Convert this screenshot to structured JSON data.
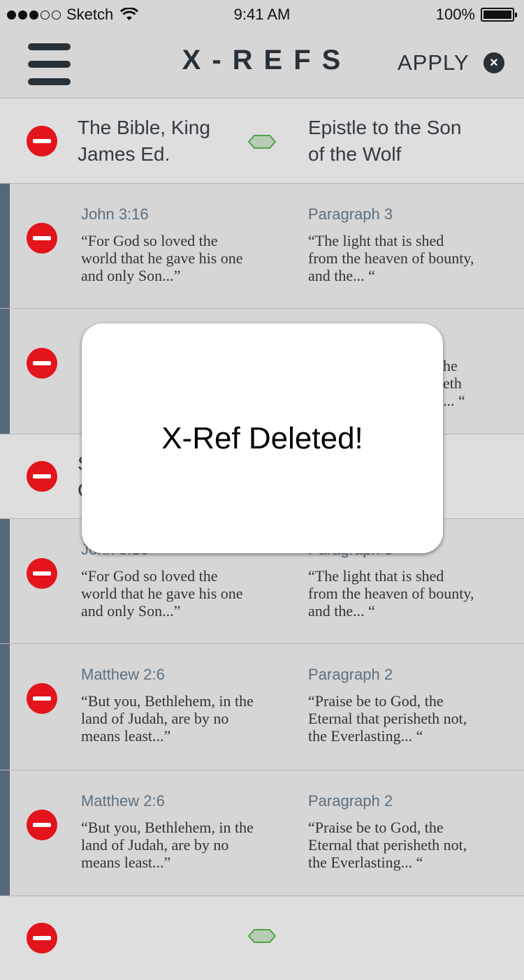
{
  "status_bar": {
    "carrier": "Sketch",
    "time": "9:41 AM",
    "battery": "100%"
  },
  "nav": {
    "title": "X-REFS",
    "apply_label": "APPLY",
    "close_label": "×",
    "menu_icon": "hamburger-icon"
  },
  "groups": [
    {
      "left": "The Bible, King James Ed.",
      "right": "Epistle to the Son of the Wolf",
      "link_icon": "link-icon"
    },
    {
      "left": "S",
      "right": "",
      "left2": "C"
    },
    {
      "left": "",
      "right": ""
    }
  ],
  "refs": [
    {
      "left_label": "John 3:16",
      "left_quote": "“For God so loved the world that he gave his one and only Son...”",
      "right_label": "Paragraph 3",
      "right_quote": "“The light that is shed from the heaven of bounty, and the... “"
    },
    {
      "left_label": "",
      "left_quote": "",
      "right_label": "",
      "right_quote": "he\neth\n... “"
    },
    {
      "left_label": "John 3:16",
      "left_quote": "“For God so loved the world that he gave his one and only Son...”",
      "right_label": "Paragraph 3",
      "right_quote": "“The light that is shed from the heaven of bounty, and the... “"
    },
    {
      "left_label": "Matthew 2:6",
      "left_quote": "“But you, Bethlehem, in the land of Judah, are by no means least...”",
      "right_label": "Paragraph 2",
      "right_quote": "“Praise be to God, the Eternal that perisheth not, the Everlasting... “"
    },
    {
      "left_label": "Matthew 2:6",
      "left_quote": "“But you, Bethlehem, in the land of Judah, are by no means least...”",
      "right_label": "Paragraph 2",
      "right_quote": "“Praise be to God, the Eternal that perisheth not, the Everlasting... “"
    }
  ],
  "toast": {
    "message": "X-Ref Deleted!"
  },
  "colors": {
    "accent": "#566878",
    "delete": "#e3141b",
    "link": "#5c7080",
    "link_icon_fill": "#b6ccb4",
    "link_icon_stroke": "#4fa24a"
  }
}
